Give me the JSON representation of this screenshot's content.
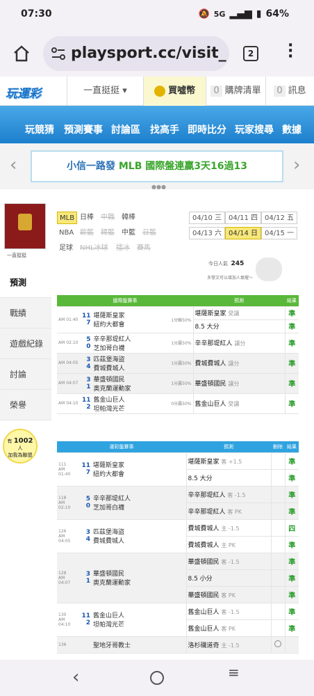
{
  "status": {
    "time": "07:30",
    "signal": "5G",
    "battery": "64%"
  },
  "browser": {
    "url": "playsport.cc/visit_",
    "tab_count": "2"
  },
  "site": {
    "logo": "玩運彩",
    "menu": "一直挺挺 ▾",
    "coin": "買噓幣",
    "cart_count": "0",
    "cart": "購牌清單",
    "msg_count": "0",
    "msg": "訊息"
  },
  "nav": [
    "玩競猜",
    "預測賽事",
    "討論區",
    "找高手",
    "即時比分",
    "玩家搜尋",
    "數據"
  ],
  "banner": {
    "text_prefix": "小信一路發 ",
    "text_main": "MLB 國際盤連贏3天16過13"
  },
  "sidebar": {
    "username": "一直挺挺",
    "tabs": [
      "預測",
      "戰績",
      "遊戲紀錄",
      "討論",
      "榮譽"
    ],
    "notice_pre": "有",
    "notice_count": "1002",
    "notice_unit": "人",
    "notice_post": "加我為聯盟"
  },
  "leagues": {
    "row1": [
      {
        "l": "MLB",
        "s": "act"
      },
      {
        "l": "日棒",
        "s": ""
      },
      {
        "l": "中職",
        "s": "dis"
      },
      {
        "l": "韓棒",
        "s": ""
      }
    ],
    "row2": [
      {
        "l": "NBA",
        "s": ""
      },
      {
        "l": "歐籃",
        "s": "dis"
      },
      {
        "l": "韓籃",
        "s": "dis"
      },
      {
        "l": "中籃",
        "s": ""
      },
      {
        "l": "日籃",
        "s": "dis"
      }
    ],
    "row3": [
      {
        "l": "足球",
        "s": ""
      },
      {
        "l": "NHL冰球",
        "s": "dis"
      },
      {
        "l": "擂冰",
        "s": "dis"
      },
      {
        "l": "賽馬",
        "s": "dis"
      }
    ]
  },
  "dates": [
    {
      "l": "04/10 三",
      "s": ""
    },
    {
      "l": "04/11 四",
      "s": ""
    },
    {
      "l": "04/12 五",
      "s": ""
    },
    {
      "l": "04/13 六",
      "s": ""
    },
    {
      "l": "04/14 日",
      "s": "act"
    },
    {
      "l": "04/15 一",
      "s": ""
    }
  ],
  "today": {
    "label": "今日人氣",
    "count": "245",
    "hint": "多發文可以增加人氣喔～"
  },
  "intl": {
    "headers": [
      "國際盤賽事",
      "預測",
      "結果"
    ],
    "rows": [
      {
        "time": "AM 01:40",
        "s1": "11",
        "t1": "堪薩斯皇家",
        "s2": "7",
        "t2": "紐約大都會",
        "line": "1分輸50%",
        "picks": [
          {
            "p": "堪薩斯皇家",
            "n": "受讓",
            "r": "準"
          },
          {
            "p": "8.5 大分",
            "n": "",
            "r": "準"
          }
        ],
        "bg": "w"
      },
      {
        "time": "AM 02:10",
        "s1": "5",
        "t1": "辛辛那堤紅人",
        "s2": "0",
        "t2": "芝加哥白襪",
        "line": "1分贏50%",
        "picks": [
          {
            "p": "辛辛那堤紅人",
            "n": "讓分",
            "r": "準"
          }
        ],
        "bg": "w"
      },
      {
        "time": "AM 04:05",
        "s1": "3",
        "t1": "匹茲堡海盜",
        "s2": "4",
        "t2": "費城費城人",
        "line": "1分贏50%",
        "picks": [
          {
            "p": "費城費城人",
            "n": "讓分",
            "r": "準"
          }
        ],
        "bg": "g"
      },
      {
        "time": "AM 04:07",
        "s1": "3",
        "t1": "華盛頓國民",
        "s2": "1",
        "t2": "奧克蘭運動家",
        "line": "1分贏50%",
        "picks": [
          {
            "p": "華盛頓國民",
            "n": "讓分",
            "r": "準"
          }
        ],
        "bg": "g"
      },
      {
        "time": "AM 04:10",
        "s1": "11",
        "t1": "舊金山巨人",
        "s2": "2",
        "t2": "坦帕灣光芒",
        "line": "0分贏50%",
        "picks": [
          {
            "p": "舊金山巨人",
            "n": "受讓",
            "r": "準"
          }
        ],
        "bg": "w"
      }
    ]
  },
  "sport": {
    "headers": [
      "運彩盤賽事",
      "預測",
      "刪除",
      "結果"
    ],
    "rows": [
      {
        "no": "111",
        "time": "AM 01:40",
        "s1": "11",
        "t1": "堪薩斯皇家",
        "s2": "7",
        "t2": "紐約大都會",
        "picks": [
          {
            "p": "堪薩斯皇家",
            "n": "客 +1.5",
            "r": "準"
          },
          {
            "p": "8.5 大分",
            "n": "",
            "r": "準"
          }
        ],
        "bg": "w"
      },
      {
        "no": "118",
        "time": "AM 02:10",
        "s1": "5",
        "t1": "辛辛那堤紅人",
        "s2": "0",
        "t2": "芝加哥白襪",
        "picks": [
          {
            "p": "辛辛那堤紅人",
            "n": "客 -1.5",
            "r": "準"
          },
          {
            "p": "辛辛那堤紅人",
            "n": "客 PK",
            "r": "準"
          }
        ],
        "bg": "g"
      },
      {
        "no": "126",
        "time": "AM 04:05",
        "s1": "3",
        "t1": "匹茲堡海盜",
        "s2": "4",
        "t2": "費城費城人",
        "picks": [
          {
            "p": "費城費城人",
            "n": "主 -1.5",
            "r": "四"
          },
          {
            "p": "費城費城人",
            "n": "主 PK",
            "r": "準"
          }
        ],
        "bg": "w"
      },
      {
        "no": "128",
        "time": "AM 04:07",
        "s1": "3",
        "t1": "華盛頓國民",
        "s2": "1",
        "t2": "奧克蘭運動家",
        "picks": [
          {
            "p": "華盛頓國民",
            "n": "客 -1.5",
            "r": "準"
          },
          {
            "p": "8.5 小分",
            "n": "",
            "r": "準"
          },
          {
            "p": "華盛頓國民",
            "n": "客 PK",
            "r": "準"
          }
        ],
        "bg": "g"
      },
      {
        "no": "130",
        "time": "AM 04:10",
        "s1": "11",
        "t1": "舊金山巨人",
        "s2": "2",
        "t2": "坦帕灣光芒",
        "picks": [
          {
            "p": "舊金山巨人",
            "n": "客 -1.5",
            "r": "準"
          },
          {
            "p": "舊金山巨人",
            "n": "客 PK",
            "r": "準"
          }
        ],
        "bg": "w"
      },
      {
        "no": "136",
        "time": "",
        "s1": "",
        "t1": "聖地牙哥教士",
        "s2": "",
        "t2": "",
        "picks": [
          {
            "p": "洛杉磯道奇",
            "n": "主 -1.5",
            "r": ""
          }
        ],
        "bg": "g"
      }
    ]
  }
}
